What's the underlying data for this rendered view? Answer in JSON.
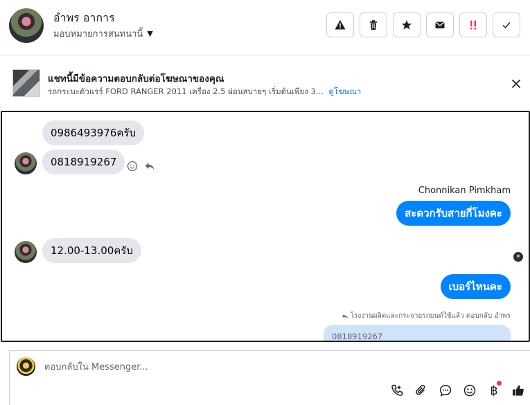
{
  "header": {
    "contact_name": "อำพร อาการ",
    "assign_label": "มอบหมายการสนทนานี้",
    "actions": [
      {
        "icon": "warning-icon",
        "label": "Report"
      },
      {
        "icon": "trash-icon",
        "label": "Delete"
      },
      {
        "icon": "star-icon",
        "label": "Star"
      },
      {
        "icon": "envelope-icon",
        "label": "Mark unread"
      },
      {
        "icon": "spam-icon",
        "label": "Spam"
      },
      {
        "icon": "checkmark-icon",
        "label": "Mark done"
      }
    ]
  },
  "ad_banner": {
    "title": "แชทนี้มีข้อความตอบกลับต่อโฆษณาของคุณ",
    "subtitle": "รถกระบะตัวแรร์ FORD RANGER 2011 เครื่อง 2.5 ผ่อนสบายๆ เริ่มต้นเพียง 3...",
    "link": "ดูโฆษณา"
  },
  "conversation": {
    "messages": [
      {
        "direction": "in",
        "text": "0986493976ครับ"
      },
      {
        "direction": "in",
        "text": "0818919267"
      },
      {
        "direction": "out",
        "text": "สะดวกรับสายกี่โมงคะ"
      },
      {
        "direction": "in",
        "text": "12.00-13.00ครับ"
      },
      {
        "direction": "out",
        "text": "เบอร์ไหนคะ"
      }
    ],
    "outgoing_sender": "Chonnikan Pimkham",
    "reply_note": "โรงงานผลิตและกระจายรถยนต์ใช้แล้ว ตอบกลับ อำพร",
    "reply_quote": "0818919267"
  },
  "composer": {
    "placeholder": "ตอบกลับใน Messenger...",
    "tools": [
      "call-icon",
      "attachment-icon",
      "saved-reply-icon",
      "emoji-icon",
      "baht-icon",
      "thumbs-up-icon"
    ],
    "baht_symbol": "฿"
  },
  "colors": {
    "outgoing_bubble": "#0084ff",
    "incoming_bubble": "#e4e6eb",
    "quote_bubble": "#cfe3fb",
    "link": "#216fdb",
    "spam_red": "#e53950"
  }
}
